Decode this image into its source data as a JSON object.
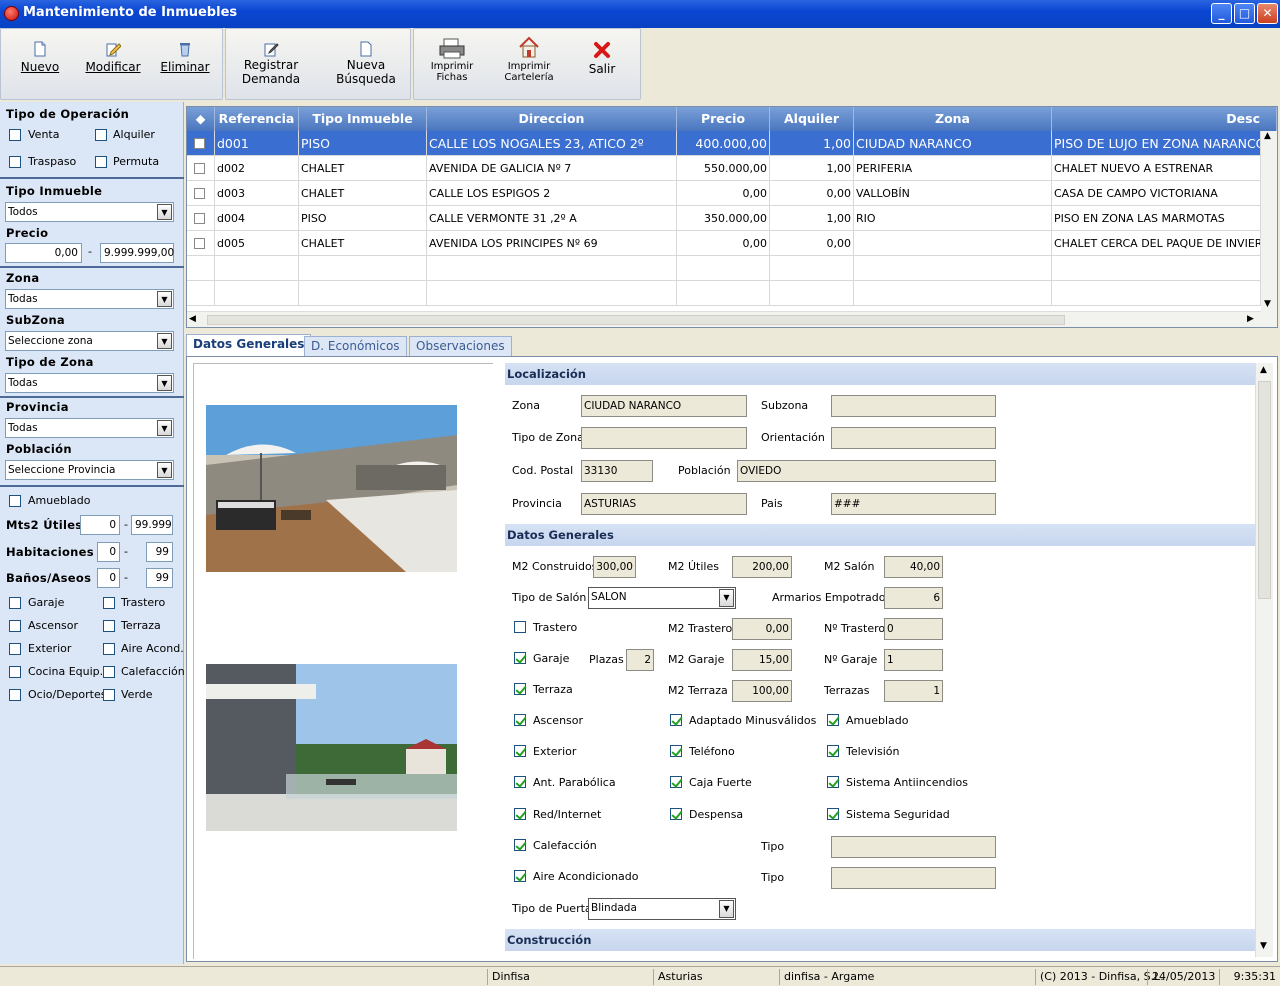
{
  "window": {
    "title": "Mantenimiento de Inmuebles",
    "minimize": "_",
    "maximize": "□",
    "close": "✕"
  },
  "toolbar": {
    "nuevo": "Nuevo",
    "modificar": "Modificar",
    "eliminar": "Eliminar",
    "registrar_demanda_1": "Registrar",
    "registrar_demanda_2": "Demanda",
    "nueva_busqueda_1": "Nueva",
    "nueva_busqueda_2": "Búsqueda",
    "imprimir_fichas_1": "Imprimir",
    "imprimir_fichas_2": "Fichas",
    "imprimir_carteleria_1": "Imprimir",
    "imprimir_carteleria_2": "Cartelería",
    "salir": "Salir"
  },
  "filters": {
    "tipo_operacion": "Tipo de Operación",
    "venta": "Venta",
    "alquiler": "Alquiler",
    "traspaso": "Traspaso",
    "permuta": "Permuta",
    "tipo_inmueble": "Tipo Inmueble",
    "tipo_inmueble_value": "Todos",
    "precio": "Precio",
    "precio_min": "0,00",
    "precio_sep": "-",
    "precio_max": "9.999.999,00",
    "zona": "Zona",
    "zona_value": "Todas",
    "subzona": "SubZona",
    "subzona_value": "Seleccione zona",
    "tipo_zona": "Tipo de Zona",
    "tipo_zona_value": "Todas",
    "provincia": "Provincia",
    "provincia_value": "Todas",
    "poblacion": "Población",
    "poblacion_value": "Seleccione Provincia",
    "amueblado": "Amueblado",
    "mts2": "Mts2 Útiles",
    "mts2_min": "0",
    "mts2_max": "99.999",
    "habitaciones": "Habitaciones",
    "hab_min": "0",
    "hab_max": "99",
    "banos": "Baños/Aseos",
    "banos_min": "0",
    "banos_max": "99",
    "range_sep": "-",
    "garaje": "Garaje",
    "trastero": "Trastero",
    "ascensor": "Ascensor",
    "terraza": "Terraza",
    "exterior": "Exterior",
    "aire": "Aire Acond.",
    "cocina": "Cocina Equip.",
    "calefaccion": "Calefacción",
    "ocio": "Ocio/Deportes",
    "verde": "Verde"
  },
  "grid": {
    "columns": [
      "Referencia",
      "Tipo Inmueble",
      "Direccion",
      "Precio",
      "Alquiler",
      "Zona",
      "Desc"
    ],
    "rows": [
      {
        "ref": "d001",
        "tipo": "PISO",
        "dir": "CALLE LOS NOGALES 23, ATICO 2º",
        "precio": "400.000,00",
        "alquiler": "1,00",
        "zona": "CIUDAD NARANCO",
        "desc": "PISO DE LUJO EN ZONA NARANCO"
      },
      {
        "ref": "d002",
        "tipo": "CHALET",
        "dir": "AVENIDA DE GALICIA Nº 7",
        "precio": "550.000,00",
        "alquiler": "1,00",
        "zona": "PERIFERIA",
        "desc": "CHALET NUEVO A ESTRENAR"
      },
      {
        "ref": "d003",
        "tipo": "CHALET",
        "dir": "CALLE LOS ESPIGOS 2",
        "precio": "0,00",
        "alquiler": "0,00",
        "zona": "VALLOBÍN",
        "desc": "CASA DE CAMPO VICTORIANA"
      },
      {
        "ref": "d004",
        "tipo": "PISO",
        "dir": "CALLE VERMONTE 31 ,2º A",
        "precio": "350.000,00",
        "alquiler": "1,00",
        "zona": "RIO",
        "desc": "PISO EN ZONA LAS MARMOTAS"
      },
      {
        "ref": "d005",
        "tipo": "CHALET",
        "dir": "AVENIDA LOS PRINCIPES Nº 69",
        "precio": "0,00",
        "alquiler": "0,00",
        "zona": "",
        "desc": "CHALET CERCA DEL PAQUE DE INVIERNO"
      }
    ]
  },
  "tabs": [
    "Datos Generales",
    "D. Económicos",
    "Observaciones"
  ],
  "localizacion": {
    "header": "Localización",
    "zona_l": "Zona",
    "zona": "CIUDAD NARANCO",
    "subzona_l": "Subzona",
    "subzona": "",
    "tipo_zona_l": "Tipo de Zona",
    "tipo_zona": "",
    "orientacion_l": "Orientación",
    "orientacion": "",
    "cp_l": "Cod. Postal",
    "cp": "33130",
    "poblacion_l": "Población",
    "poblacion": "OVIEDO",
    "provincia_l": "Provincia",
    "provincia": "ASTURIAS",
    "pais_l": "Pais",
    "pais": "###"
  },
  "datos": {
    "header": "Datos Generales",
    "m2c_l": "M2 Construidos",
    "m2c": "300,00",
    "m2u_l": "M2 Útiles",
    "m2u": "200,00",
    "m2s_l": "M2 Salón",
    "m2s": "40,00",
    "tipo_salon_l": "Tipo de Salón",
    "tipo_salon": "SALON",
    "armarios_l": "Armarios Empotrados",
    "armarios": "6",
    "trastero_l": "Trastero",
    "m2t_l": "M2 Trastero",
    "m2t": "0,00",
    "nt_l": "Nº Trastero",
    "nt": "0",
    "garaje_l": "Garaje",
    "plazas_l": "Plazas",
    "plazas": "2",
    "m2g_l": "M2 Garaje",
    "m2g": "15,00",
    "ng_l": "Nº Garaje",
    "ng": "1",
    "terraza_l": "Terraza",
    "m2te_l": "M2 Terraza",
    "m2te": "100,00",
    "terrazas_l": "Terrazas",
    "terrazas": "1",
    "ascensor": "Ascensor",
    "adaptado": "Adaptado Minusválidos",
    "amueblado": "Amueblado",
    "exterior": "Exterior",
    "telefono": "Teléfono",
    "television": "Televisión",
    "antena": "Ant. Parabólica",
    "caja": "Caja Fuerte",
    "antiincendios": "Sistema Antiincendios",
    "red": "Red/Internet",
    "despensa": "Despensa",
    "seguridad": "Sistema Seguridad",
    "calefaccion": "Calefacción",
    "tipo_l": "Tipo",
    "aire": "Aire Acondicionado",
    "puerta_l": "Tipo de Puerta",
    "puerta": "Blindada"
  },
  "construccion": {
    "header": "Construcción"
  },
  "status": {
    "app": "Dinfisa",
    "region": "Asturias",
    "user": "dinfisa - Argame",
    "copyright": "(C) 2013 - Dinfisa, S.L.",
    "date": "24/05/2013",
    "time": "9:35:31"
  }
}
